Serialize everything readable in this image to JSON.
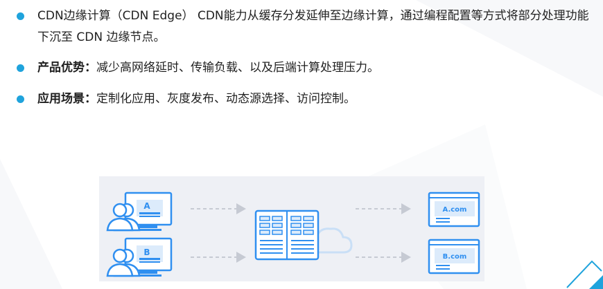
{
  "bullets": [
    {
      "strong": "",
      "text": "CDN边缘计算（CDN Edge） CDN能力从缓存分发延伸至边缘计算，通过编程配置等方式将部分处理功能下沉至 CDN 边缘节点。"
    },
    {
      "strong": "产品优势：",
      "text": "减少高网络延时、传输负载、以及后端计算处理压力。"
    },
    {
      "strong": "应用场景：",
      "text": "定制化应用、灰度发布、动态源选择、访问控制。"
    }
  ],
  "diagram": {
    "client_a_label": "A",
    "client_b_label": "B",
    "site_a_label": "A.com",
    "site_b_label": "B.com"
  },
  "colors": {
    "accent": "#1fa3dc",
    "icon_blue": "#2f8ff0",
    "icon_light": "#dcebfb",
    "diagram_bg": "#eef0f5",
    "arrow": "#c6cad3"
  },
  "icons": [
    "user-pair-icon",
    "monitor-icon",
    "server-icon",
    "cloud-icon",
    "webpage-icon",
    "bullet-dot-icon"
  ]
}
